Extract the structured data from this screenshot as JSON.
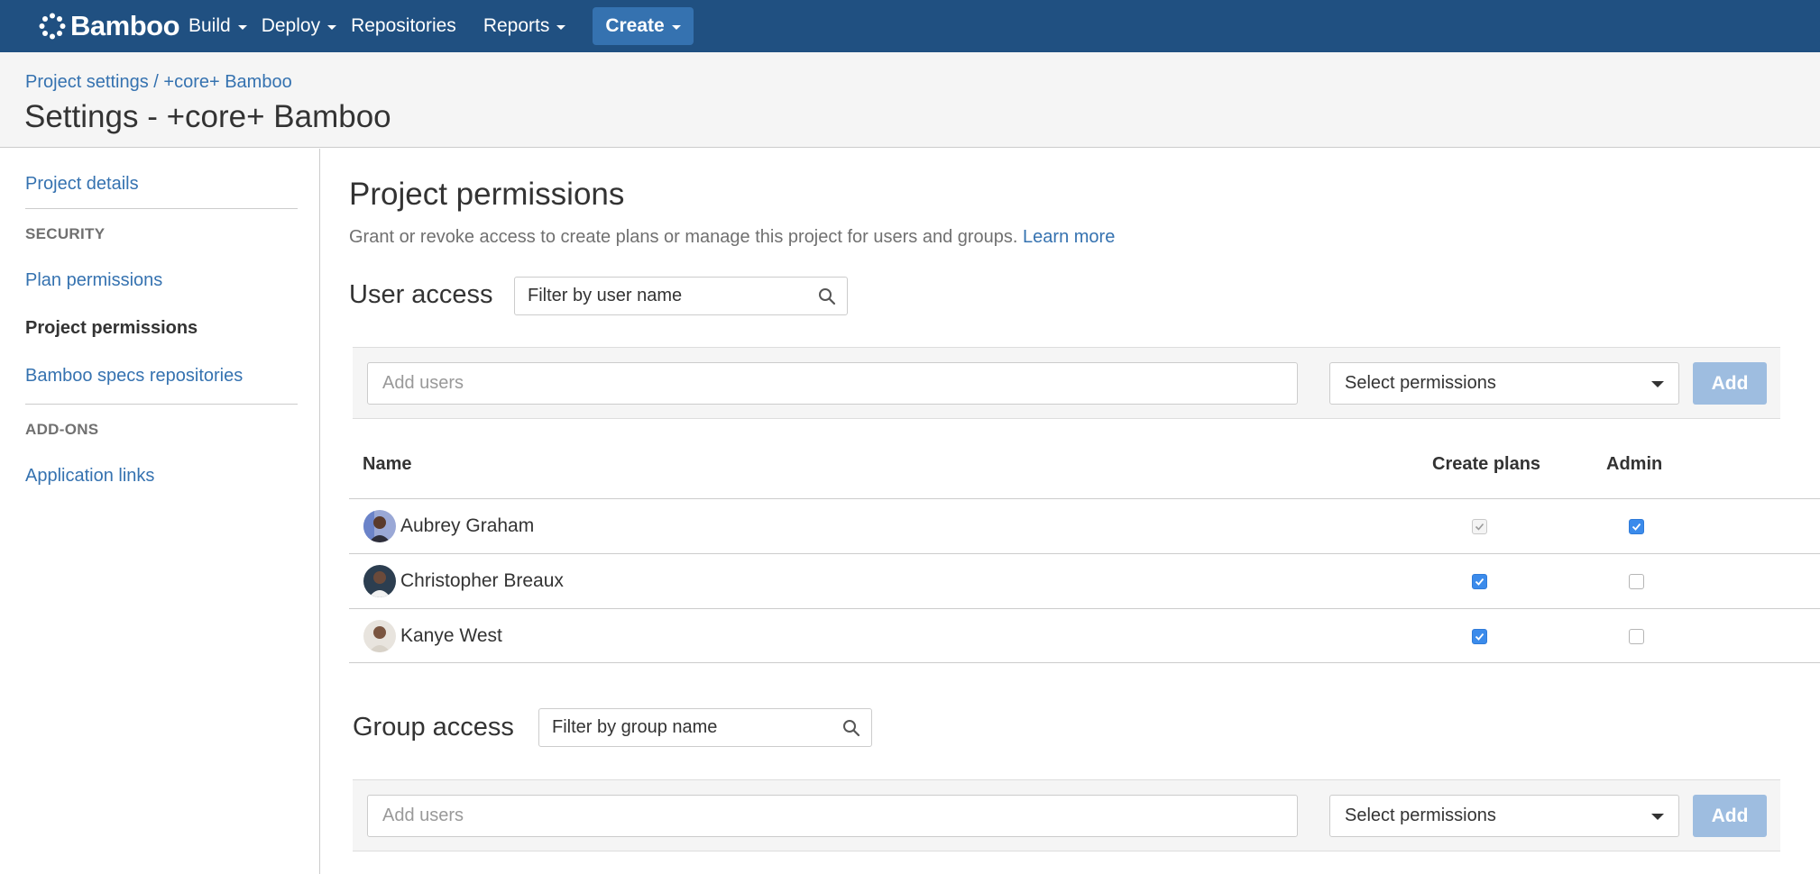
{
  "topnav": {
    "logo_text": "Bamboo",
    "items": [
      {
        "label": "Build"
      },
      {
        "label": "Deploy"
      },
      {
        "label": "Repositories"
      },
      {
        "label": "Reports"
      }
    ],
    "create_label": "Create",
    "background_color": "#205081"
  },
  "header": {
    "breadcrumb": "Project settings / +core+ Bamboo",
    "title": "Settings - +core+ Bamboo"
  },
  "sidebar": {
    "project_details": "Project details",
    "security_heading": "SECURITY",
    "plan_permissions": "Plan permissions",
    "project_permissions": "Project permissions",
    "specs_repositories": "Bamboo specs repositories",
    "addons_heading": "ADD-ONS",
    "application_links": "Application links"
  },
  "main": {
    "title": "Project permissions",
    "description": "Grant or revoke access to create plans or manage this project for users and groups.",
    "learn_more": "Learn more",
    "user_access": {
      "title": "User access",
      "filter_placeholder": "Filter by user name",
      "add_placeholder": "Add users",
      "select_label": "Select permissions",
      "add_button": "Add"
    },
    "table": {
      "columns": [
        "Name",
        "Create plans",
        "Admin"
      ],
      "rows": [
        {
          "name": "Aubrey Graham",
          "create_plans": "checked-disabled",
          "admin": "checked"
        },
        {
          "name": "Christopher Breaux",
          "create_plans": "checked",
          "admin": "unchecked"
        },
        {
          "name": "Kanye West",
          "create_plans": "checked",
          "admin": "unchecked"
        }
      ]
    },
    "group_access": {
      "title": "Group access",
      "filter_placeholder": "Filter by group name",
      "add_placeholder": "Add users",
      "select_label": "Select permissions",
      "add_button": "Add"
    }
  },
  "colors": {
    "link": "#3572b0",
    "checkbox_checked": "#3b8beb",
    "add_button_disabled": "#9ebde0"
  }
}
